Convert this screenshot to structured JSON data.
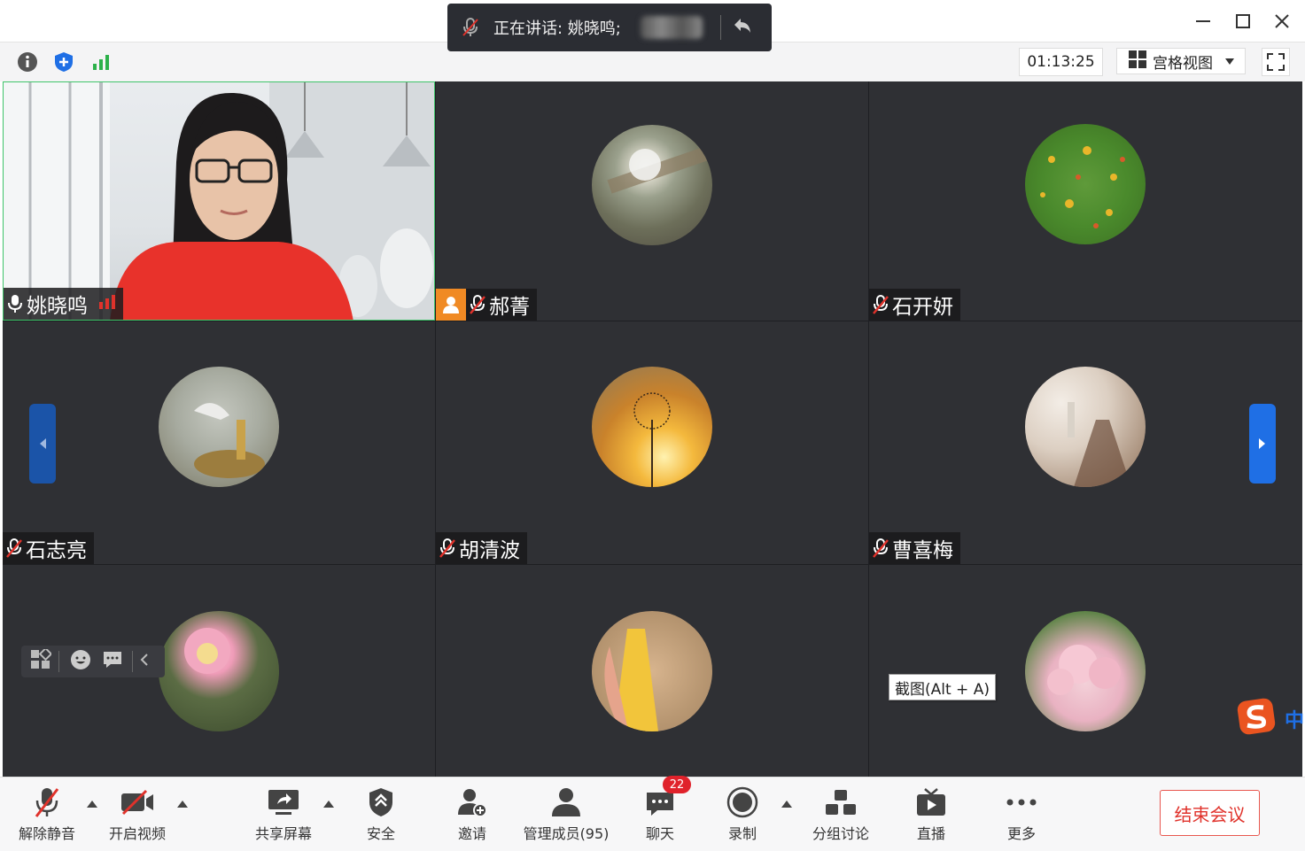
{
  "speaking": {
    "text": "正在讲话: 姚晓鸣;"
  },
  "toolbar": {
    "timer": "01:13:25",
    "view_label": "宫格视图"
  },
  "participants": [
    {
      "name": "姚晓鸣",
      "muted": false,
      "video": true,
      "host": false
    },
    {
      "name": "郝菁",
      "muted": true,
      "video": false,
      "host": true
    },
    {
      "name": "石开妍",
      "muted": true,
      "video": false,
      "host": false
    },
    {
      "name": "石志亮",
      "muted": true,
      "video": false,
      "host": false
    },
    {
      "name": "胡清波",
      "muted": true,
      "video": false,
      "host": false
    },
    {
      "name": "曹喜梅",
      "muted": true,
      "video": false,
      "host": false
    },
    {
      "name": "",
      "muted": true,
      "video": false,
      "host": false
    },
    {
      "name": "",
      "muted": true,
      "video": false,
      "host": false
    },
    {
      "name": "",
      "muted": true,
      "video": false,
      "host": false
    }
  ],
  "tooltip": "截图(Alt + A)",
  "ime_label": "中",
  "bottom": {
    "unmute": "解除静音",
    "start_video": "开启视频",
    "share_screen": "共享屏幕",
    "security": "安全",
    "invite": "邀请",
    "manage_members": "管理成员(95)",
    "chat": "聊天",
    "chat_badge": "22",
    "record": "录制",
    "breakout": "分组讨论",
    "live": "直播",
    "more": "更多",
    "end_meeting": "结束会议"
  },
  "colors": {
    "accent_blue": "#1f6fe5",
    "end_red": "#e0322b",
    "active_green": "#3fc46a",
    "tile_bg": "#2f3034"
  }
}
